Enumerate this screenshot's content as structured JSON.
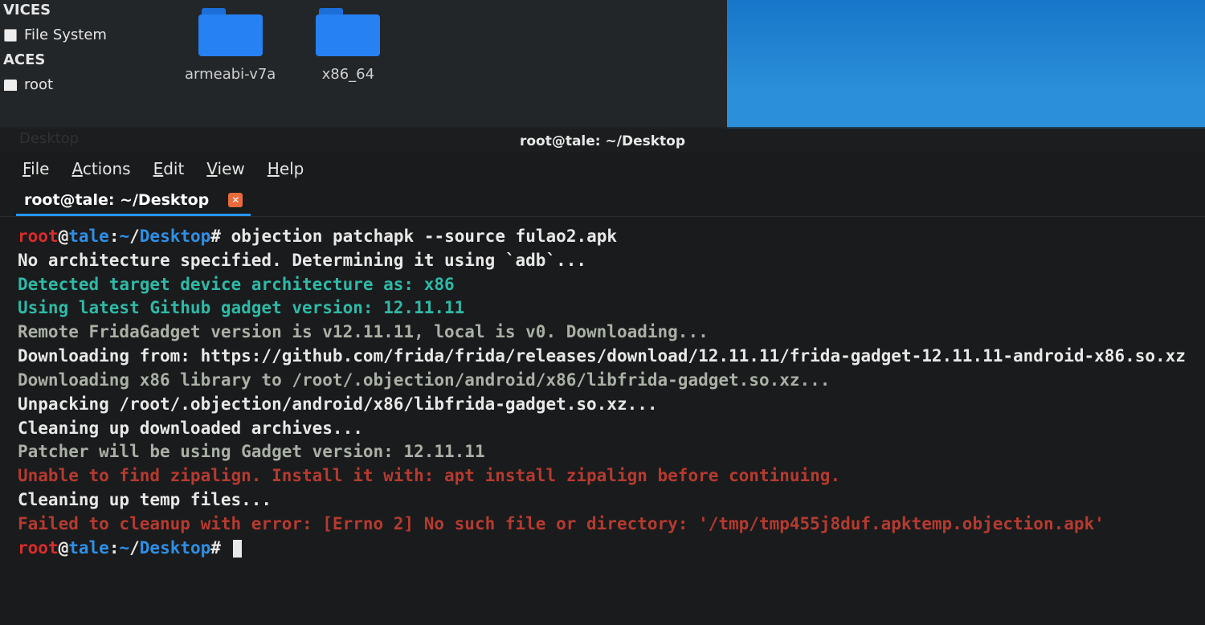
{
  "fm": {
    "devices_label": "VICES",
    "places_label": "ACES",
    "file_system": "File System",
    "root_label": "root",
    "folders": [
      {
        "name": "armeabi-v7a"
      },
      {
        "name": "x86_64"
      }
    ]
  },
  "terminal": {
    "title": "root@tale: ~/Desktop",
    "menu": {
      "file": "File",
      "actions": "Actions",
      "edit": "Edit",
      "view": "View",
      "help": "Help"
    },
    "tab": "root@tale: ~/Desktop",
    "dim_behind": "Desktop",
    "prompt": {
      "user": "root",
      "at": "@",
      "host": "tale",
      "colon": ":",
      "tilde": "~",
      "slash": "/",
      "path": "Desktop",
      "hash": "#"
    },
    "lines": {
      "cmd": " objection patchapk --source fulao2.apk",
      "l1": "No architecture specified. Determining it using `adb`...",
      "l2": "Detected target device architecture as: x86",
      "l3": "Using latest Github gadget version: 12.11.11",
      "l4": "Remote FridaGadget version is v12.11.11, local is v0. Downloading...",
      "l5": "Downloading from: https://github.com/frida/frida/releases/download/12.11.11/frida-gadget-12.11.11-android-x86.so.xz",
      "l6": "Downloading x86 library to /root/.objection/android/x86/libfrida-gadget.so.xz...",
      "l7": "Unpacking /root/.objection/android/x86/libfrida-gadget.so.xz...",
      "l8": "Cleaning up downloaded archives...",
      "l9": "Patcher will be using Gadget version: 12.11.11",
      "l10": "Unable to find zipalign. Install it with: apt install zipalign before continuing.",
      "l11": "Cleaning up temp files...",
      "l12": "Failed to cleanup with error: [Errno 2] No such file or directory: '/tmp/tmp455j8duf.apktemp.objection.apk'"
    }
  }
}
